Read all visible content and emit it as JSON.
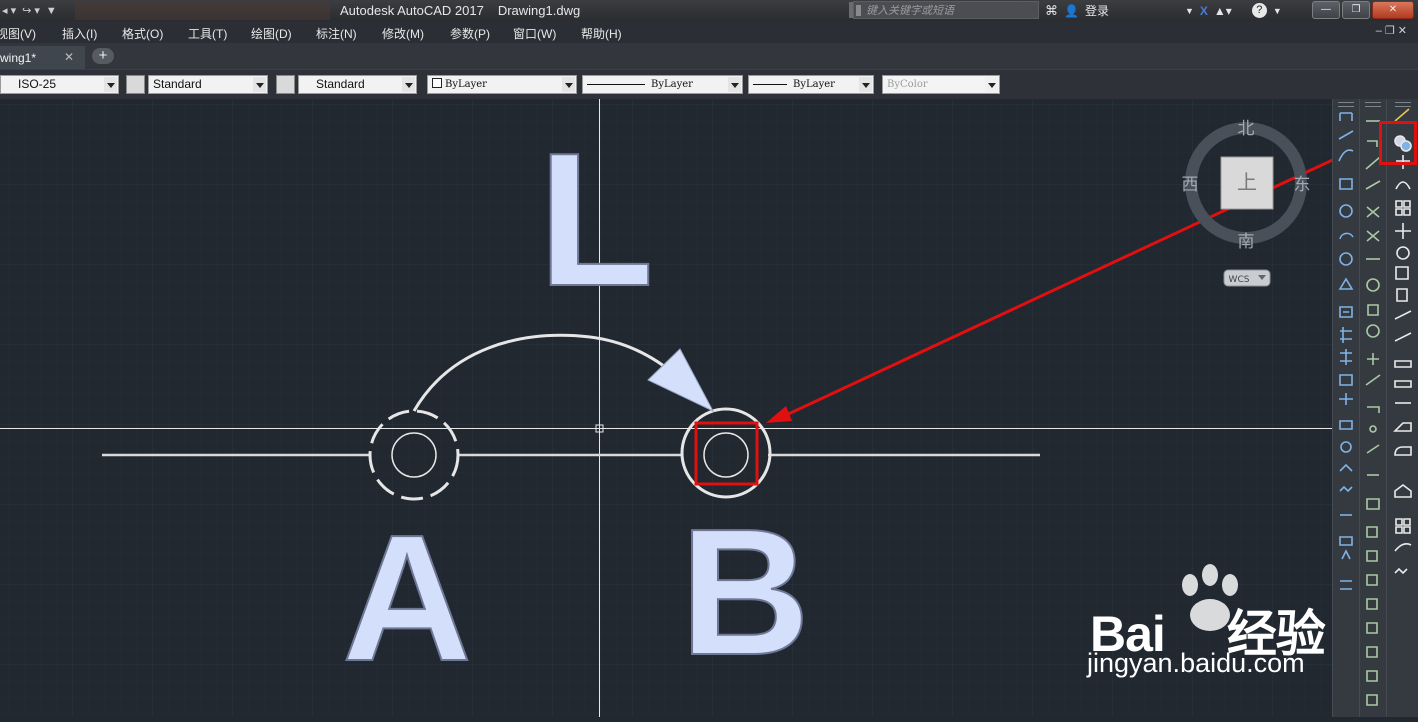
{
  "app": {
    "name": "Autodesk AutoCAD 2017",
    "document": "Drawing1.dwg",
    "search_placeholder": "键入关键字或短语",
    "login_label": "登录"
  },
  "menu": {
    "items": [
      "视图(V)",
      "插入(I)",
      "格式(O)",
      "工具(T)",
      "绘图(D)",
      "标注(N)",
      "修改(M)",
      "参数(P)",
      "窗口(W)",
      "帮助(H)"
    ]
  },
  "tabs": [
    {
      "label": "wing1*"
    }
  ],
  "properties": {
    "dim_style": "ISO-25",
    "text_style": "Standard",
    "table_style": "Standard",
    "layer": "ByLayer",
    "linetype": "ByLayer",
    "lineweight": "ByLayer",
    "plotstyle": "ByColor"
  },
  "drawing": {
    "letter_top": "L",
    "letter_left": "A",
    "letter_right": "B"
  },
  "viewcube": {
    "north": "北",
    "south": "南",
    "east": "东",
    "west": "西",
    "top_face": "上",
    "ucs": "WCS"
  },
  "colors": {
    "canvas": "#212830",
    "annotation_red": "#e01010",
    "letter_fill": "#d4dffc"
  },
  "watermark": {
    "brand": "Bai",
    "brand_tail": "经验",
    "url": "jingyan.baidu.com"
  }
}
